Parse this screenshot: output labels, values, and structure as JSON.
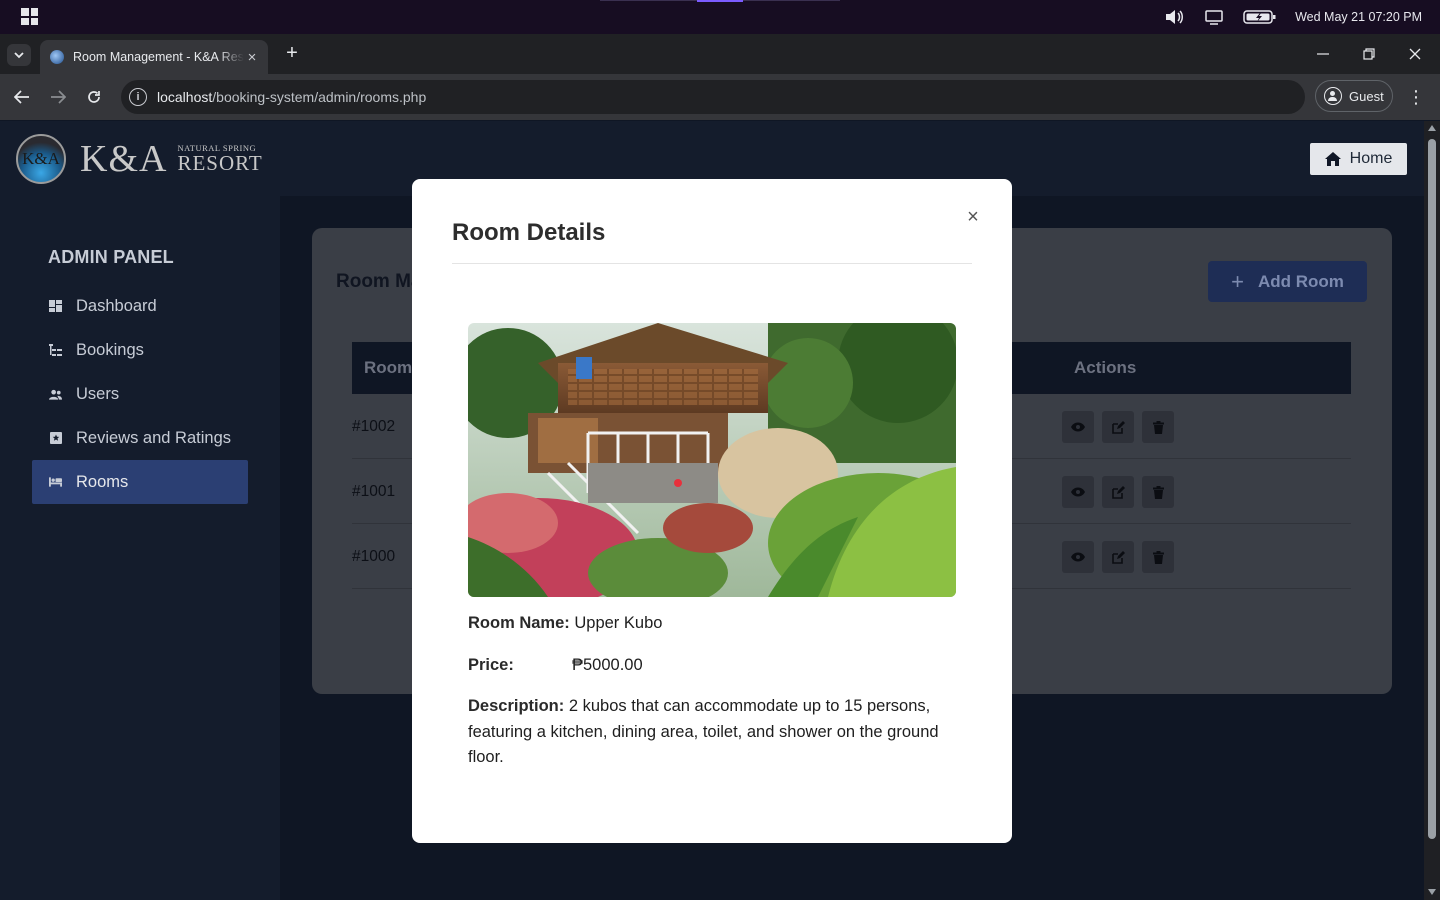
{
  "os": {
    "datetime": "Wed May 21  07:20 PM",
    "icons": [
      "windows-logo",
      "volume-icon",
      "display-icon",
      "battery-charging-icon"
    ]
  },
  "browser": {
    "tab_title": "Room Management - K&A Resort",
    "url_host": "localhost",
    "url_path": "/booking-system/admin/rooms.php",
    "profile_label": "Guest"
  },
  "header": {
    "logo_circle": "K&A",
    "logo_main": "K&A",
    "logo_small": "NATURAL SPRING",
    "logo_resort": "RESORT",
    "home_label": "Home"
  },
  "sidebar": {
    "title": "ADMIN PANEL",
    "items": [
      {
        "label": "Dashboard",
        "icon": "dashboard-icon"
      },
      {
        "label": "Bookings",
        "icon": "bookings-list-icon"
      },
      {
        "label": "Users",
        "icon": "users-icon"
      },
      {
        "label": "Reviews and Ratings",
        "icon": "reviews-icon"
      },
      {
        "label": "Rooms",
        "icon": "bed-icon",
        "active": true
      }
    ]
  },
  "main": {
    "title": "Room Ma",
    "add_room_label": "Add Room",
    "table": {
      "columns": [
        "Room",
        "Actions"
      ],
      "rows": [
        {
          "id": "#1002"
        },
        {
          "id": "#1001"
        },
        {
          "id": "#1000"
        }
      ]
    }
  },
  "modal": {
    "title": "Room Details",
    "close_glyph": "×",
    "name_label": "Room Name:",
    "name_value": "Upper Kubo",
    "price_label": "Price:",
    "price_value": "₱5000.00",
    "description_label": "Description:",
    "description_value": "2 kubos that can accommodate up to 15 persons, featuring a kitchen, dining area, toilet, and shower on the ground floor."
  },
  "colors": {
    "accent": "#2b3f73",
    "page_bg": "#0f1624",
    "header_bg": "#141c2c"
  }
}
